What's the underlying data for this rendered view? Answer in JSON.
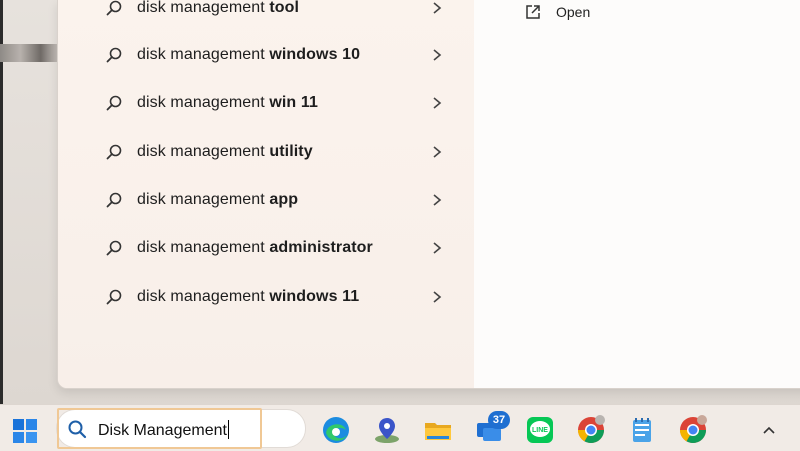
{
  "search_panel": {
    "suggestions": [
      {
        "prefix": "disk management ",
        "suffix": "tool"
      },
      {
        "prefix": "disk management ",
        "suffix": "windows 10"
      },
      {
        "prefix": "disk management ",
        "suffix": "win 11"
      },
      {
        "prefix": "disk management ",
        "suffix": "utility"
      },
      {
        "prefix": "disk management ",
        "suffix": "app"
      },
      {
        "prefix": "disk management ",
        "suffix": "administrator"
      },
      {
        "prefix": "disk management ",
        "suffix": "windows 11"
      }
    ],
    "details": {
      "open_label": "Open"
    }
  },
  "taskbar": {
    "search_value": "Disk Management",
    "badge_count": "37",
    "icons": [
      "windows-start-icon",
      "edge-icon",
      "maps-icon",
      "file-explorer-icon",
      "mail-icon",
      "line-icon",
      "chrome-icon",
      "notepad-icon",
      "chrome-profile-icon"
    ]
  },
  "colors": {
    "panel_bg": "#f7efe9",
    "details_bg": "#fdfcfb",
    "taskbar_bg": "#f1ebe6",
    "search_focus": "#f0c895",
    "accent_blue": "#1f6fd1",
    "line_green": "#06c755"
  }
}
